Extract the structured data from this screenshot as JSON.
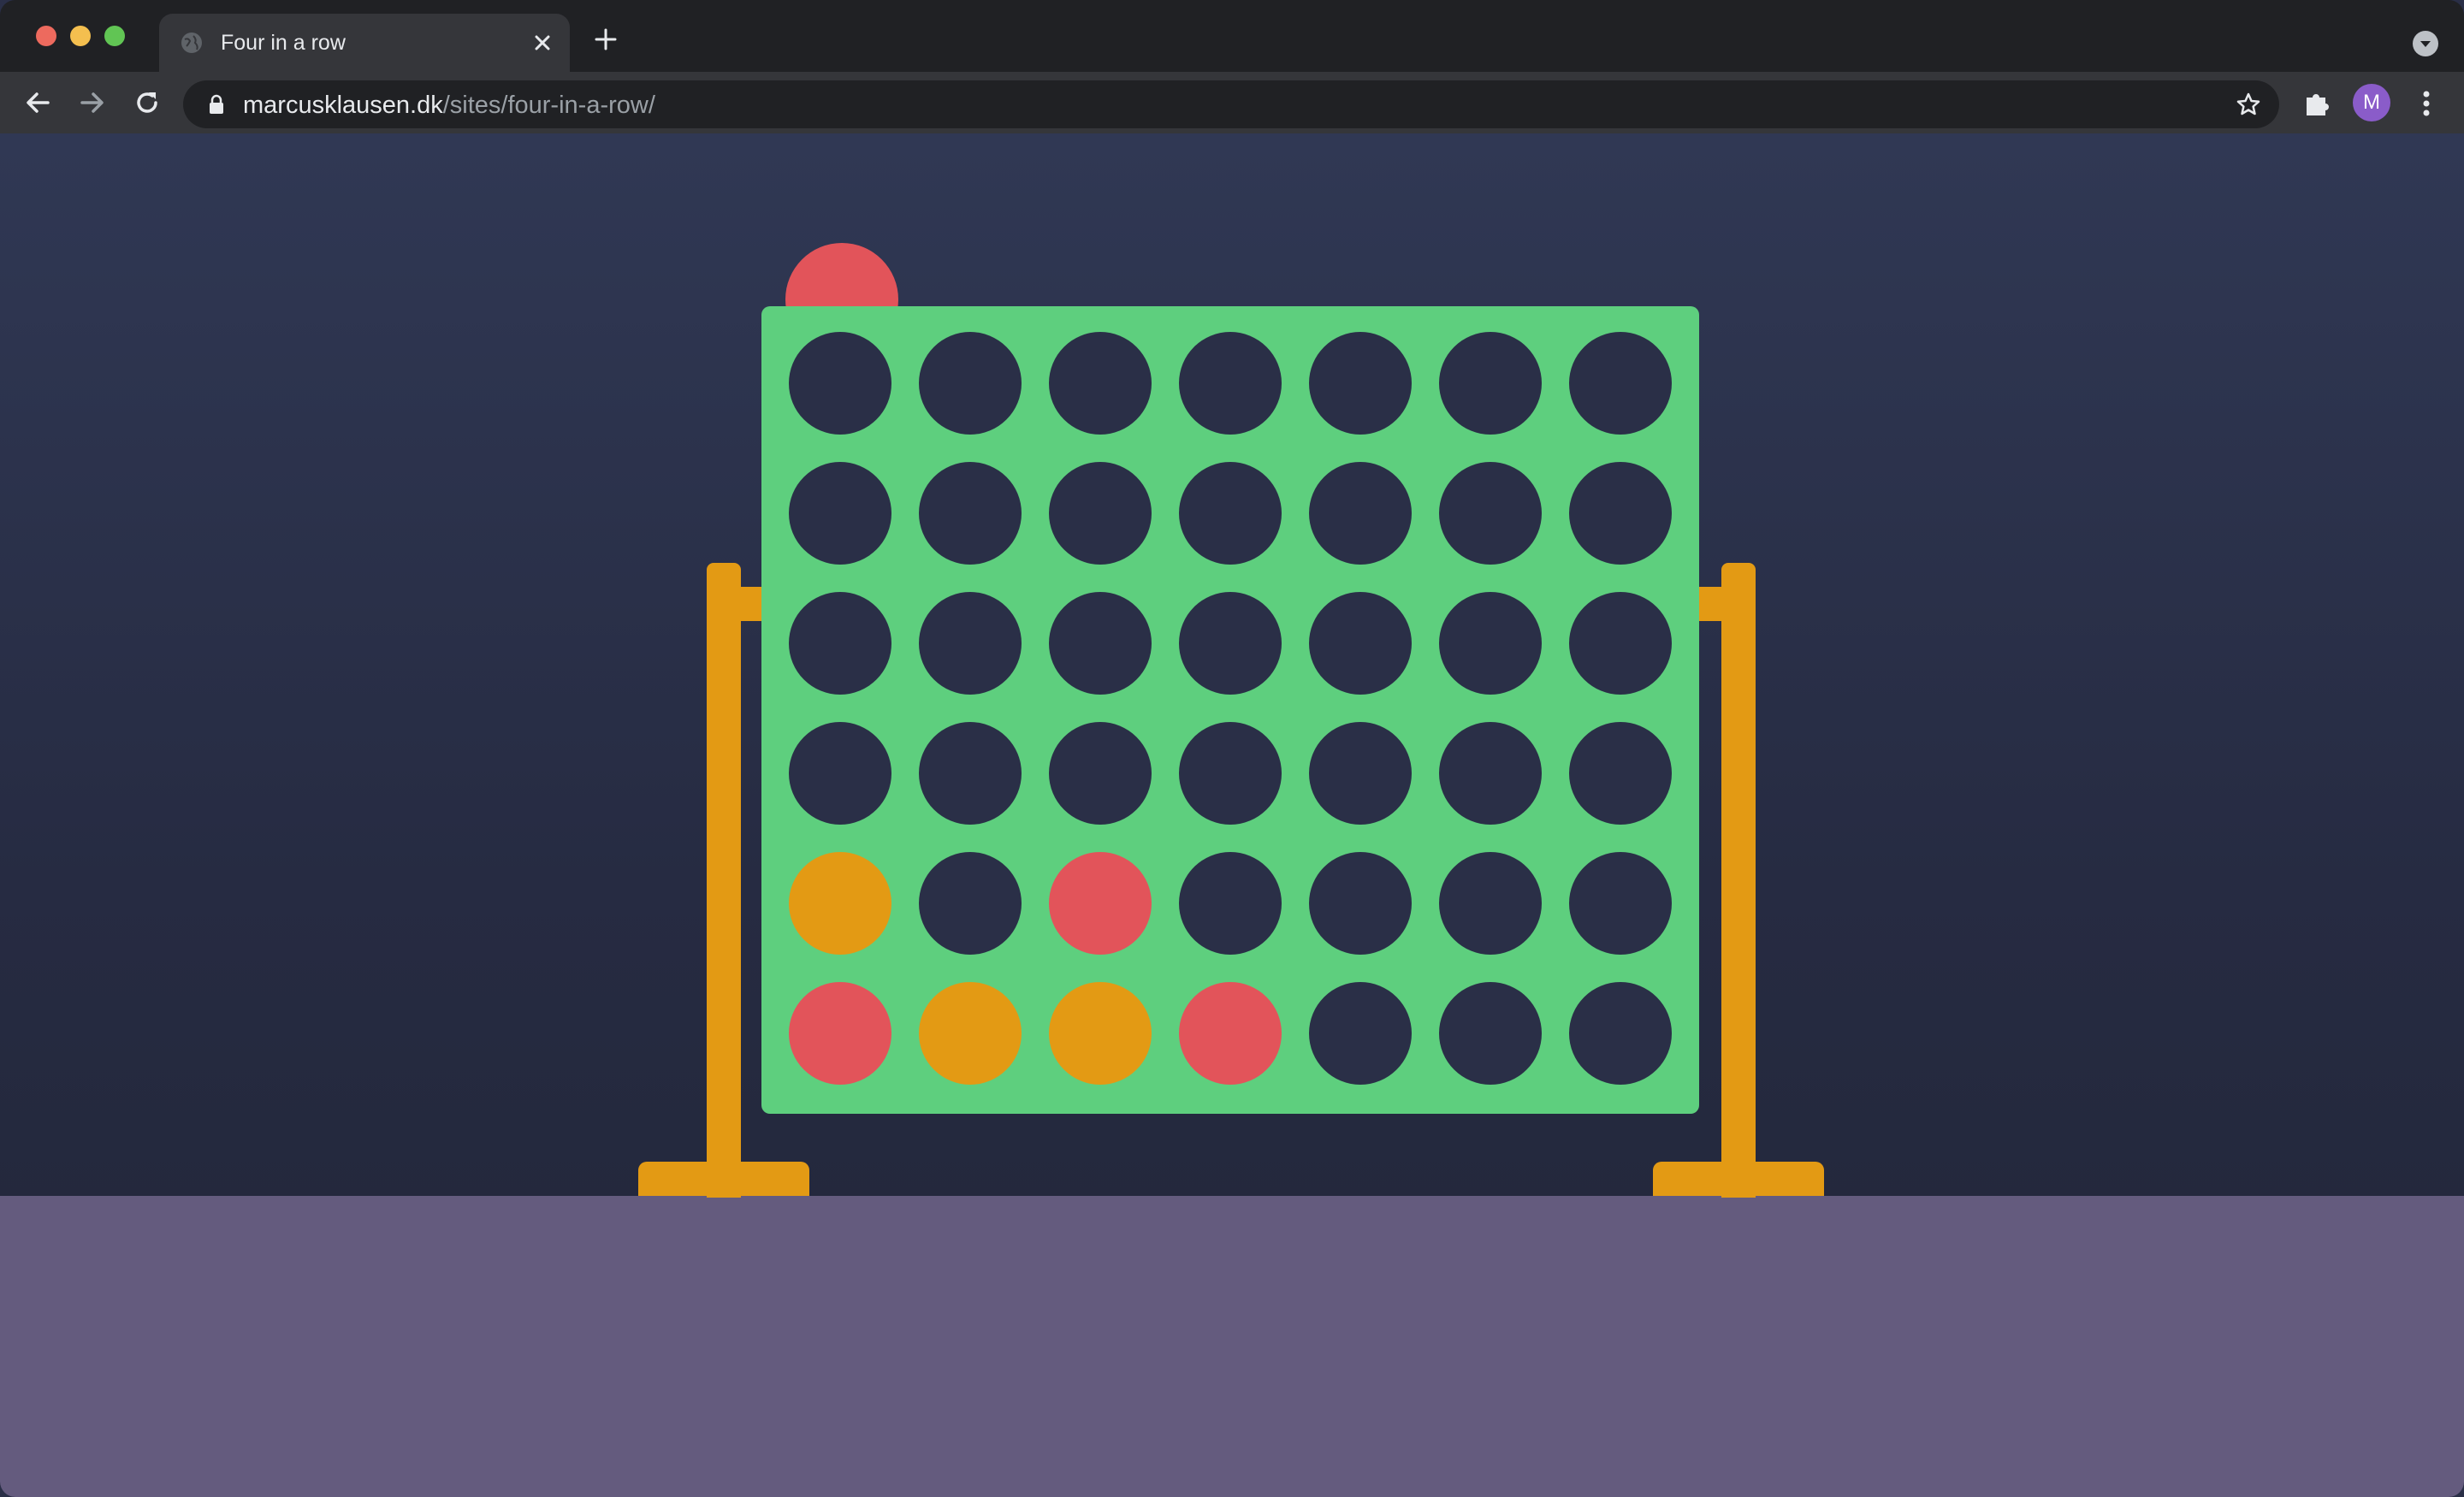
{
  "browser": {
    "tab_title": "Four in a row",
    "url_host": "marcusklausen.dk",
    "url_path": "/sites/four-in-a-row/",
    "avatar_initial": "M"
  },
  "colors": {
    "board": "#5ecf7e",
    "empty": "#2a2f47",
    "red": "#e2545a",
    "yellow": "#e39a14",
    "ground": "#645b7e"
  },
  "game": {
    "columns": 7,
    "rows": 6,
    "hover_piece": {
      "color": "red",
      "column": 0
    },
    "board": [
      [
        "empty",
        "empty",
        "empty",
        "empty",
        "empty",
        "empty",
        "empty"
      ],
      [
        "empty",
        "empty",
        "empty",
        "empty",
        "empty",
        "empty",
        "empty"
      ],
      [
        "empty",
        "empty",
        "empty",
        "empty",
        "empty",
        "empty",
        "empty"
      ],
      [
        "empty",
        "empty",
        "empty",
        "empty",
        "empty",
        "empty",
        "empty"
      ],
      [
        "yellow",
        "empty",
        "red",
        "empty",
        "empty",
        "empty",
        "empty"
      ],
      [
        "red",
        "yellow",
        "yellow",
        "red",
        "empty",
        "empty",
        "empty"
      ]
    ]
  }
}
